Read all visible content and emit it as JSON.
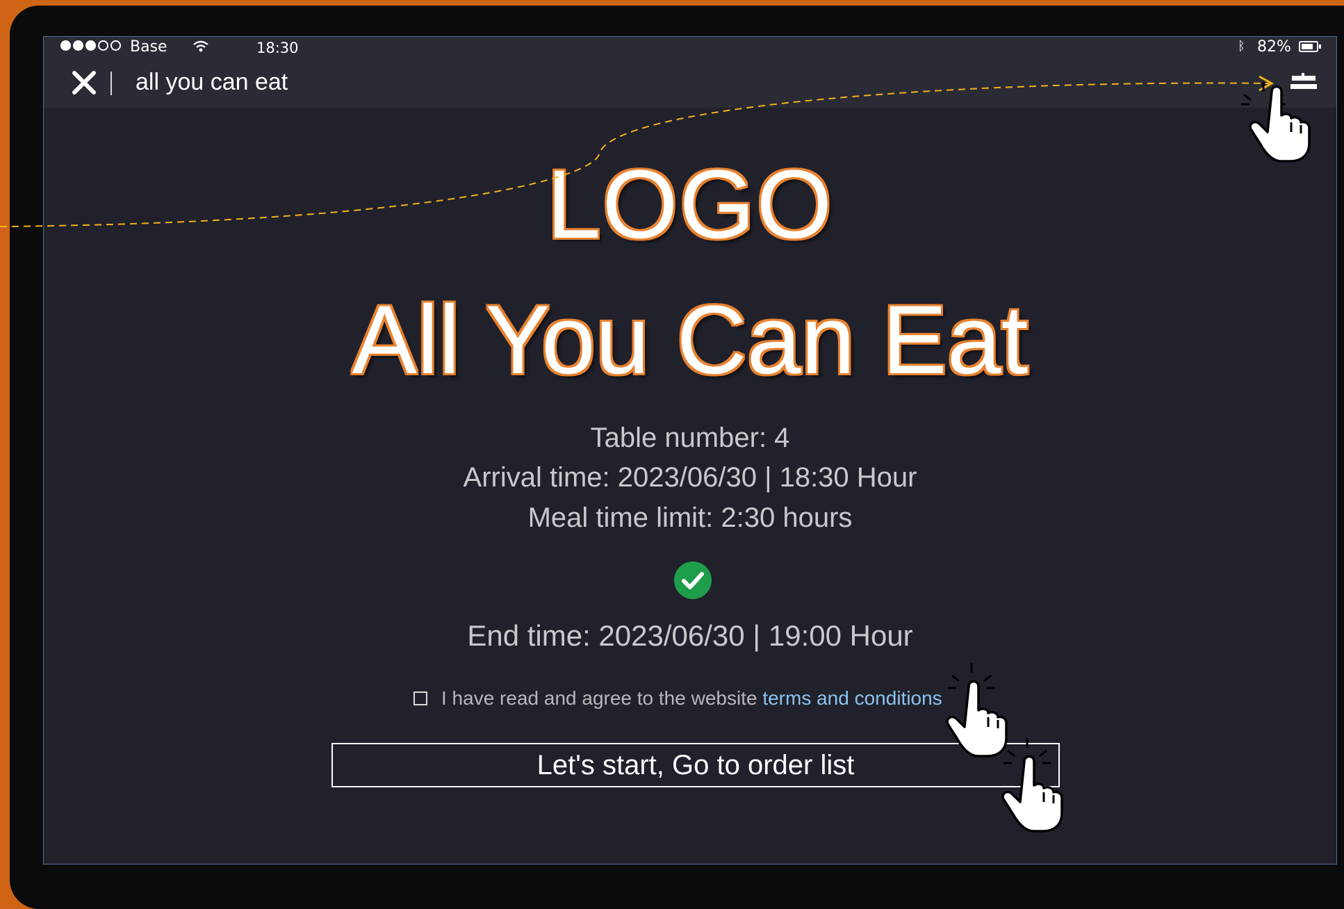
{
  "statusbar": {
    "carrier": "Base",
    "time": "18:30",
    "battery_percent": "82%",
    "battery_level": 0.82,
    "signal_bars": 3,
    "signal_total": 5
  },
  "navbar": {
    "close_icon": "close-icon",
    "title": "all you can eat",
    "menu_icon": "menu-icon"
  },
  "hero": {
    "logo_text": "LOGO",
    "headline": "All You Can Eat"
  },
  "session": {
    "table_number": "Table number: 4",
    "arrival_time": "Arrival time: 2023/06/30 | 18:30 Hour",
    "meal_time_limit": "Meal time limit: 2:30 hours",
    "end_time": "End time: 2023/06/30 | 19:00 Hour"
  },
  "agreement": {
    "text": "I have read and agree to the website",
    "link_text": "terms and conditions",
    "checked": false
  },
  "actions": {
    "start_label": "Let's start, Go to order list"
  },
  "colors": {
    "accent": "#e8822f",
    "background": "#21212b",
    "link": "#8cc3ef",
    "success": "#1e9e4a"
  }
}
